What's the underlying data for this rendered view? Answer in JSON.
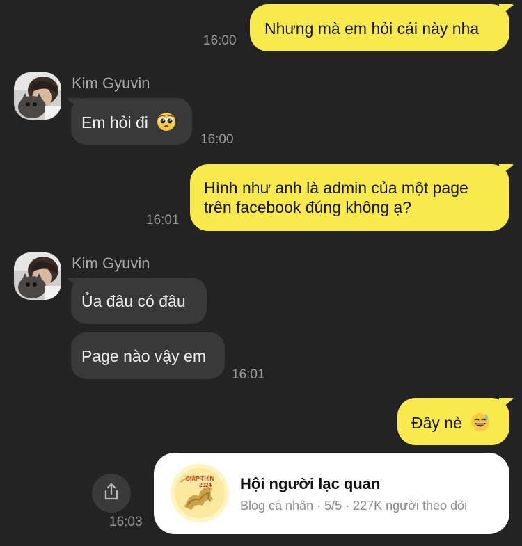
{
  "messages": {
    "m1": {
      "text": "Nhưng mà em hỏi cái này nha",
      "time": "16:00"
    },
    "m2": {
      "sender": "Kim Gyuvin",
      "text": "Em hỏi đi",
      "emoji": "pleading-face",
      "time": "16:00"
    },
    "m3": {
      "line1": "Hình như anh là admin của một page",
      "line2": "trên facebook đúng không ạ?",
      "time": "16:01"
    },
    "m4": {
      "sender": "Kim Gyuvin",
      "text": "Ủa đâu có đâu"
    },
    "m5": {
      "text": "Page nào vậy em",
      "time": "16:01"
    },
    "m6": {
      "text": "Đây nè",
      "emoji": "grinning-sweat-face"
    }
  },
  "share_card": {
    "title": "Hội người lạc quan",
    "meta": "Blog cá nhân · 5/5 · 227K người theo dõi",
    "logo_text_1": "GIÁP THÌN",
    "logo_text_2": "2024",
    "time": "16:03",
    "share_icon": "share-icon"
  },
  "colors": {
    "background": "#232323",
    "outgoing_bubble": "#f8e94c",
    "incoming_bubble": "#393939",
    "timestamp": "#9a9a9a",
    "card": "#ffffff"
  }
}
